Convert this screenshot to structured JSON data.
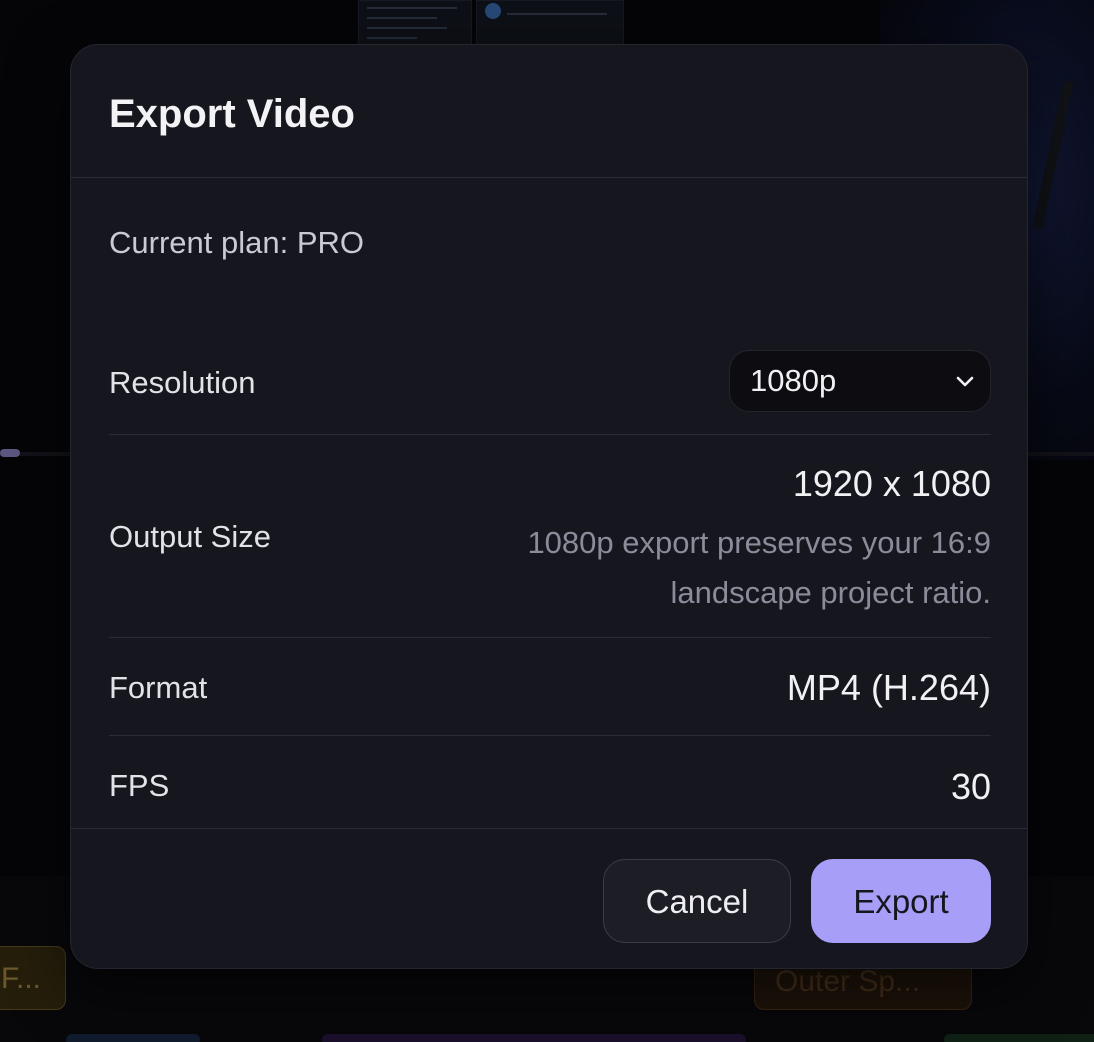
{
  "background": {
    "clip_left_label": "F...",
    "clip_right_label": "Outer Sp..."
  },
  "dialog": {
    "title": "Export Video",
    "current_plan": "Current plan: PRO",
    "resolution": {
      "label": "Resolution",
      "selected": "1080p"
    },
    "output_size": {
      "label": "Output Size",
      "value": "1920 x 1080",
      "note": "1080p export preserves your 16:9 landscape project ratio."
    },
    "format": {
      "label": "Format",
      "value": "MP4 (H.264)"
    },
    "fps": {
      "label": "FPS",
      "value": "30"
    },
    "buttons": {
      "cancel": "Cancel",
      "export": "Export"
    }
  },
  "colors": {
    "accent": "#a79ef8",
    "modal_background": "#15161e",
    "muted_text": "#8b8c99"
  },
  "icons": {
    "resolution_dropdown": "chevron-down-icon"
  }
}
